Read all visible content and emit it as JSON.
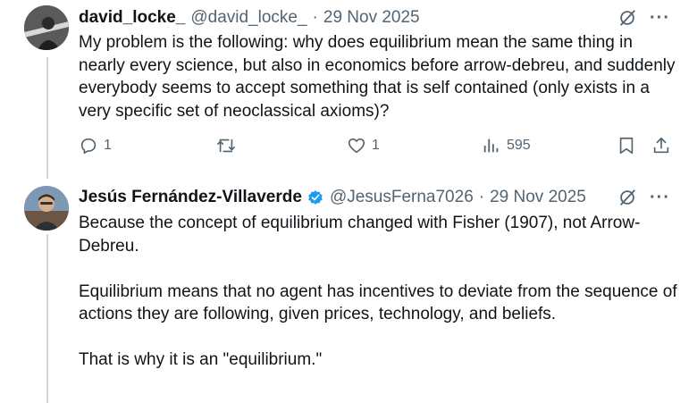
{
  "tweets": [
    {
      "name": "david_locke_",
      "handle": "@david_locke_",
      "separator": "·",
      "date": "29 Nov 2025",
      "more_label": "···",
      "text": "My problem is the following: why does equilibrium mean the same thing in nearly every science, but also in economics before arrow-debreu, and suddenly everybody seems to accept something that is self contained (only exists in a very specific set of neoclassical axioms)?",
      "actions": {
        "replies": "1",
        "reposts": "",
        "likes": "1",
        "views": "595"
      }
    },
    {
      "name": "Jesús Fernández-Villaverde",
      "handle": "@JesusFerna7026",
      "separator": "·",
      "date": "29 Nov 2025",
      "more_label": "···",
      "paragraphs": [
        "Because the concept of equilibrium changed with Fisher (1907), not Arrow-Debreu.",
        "Equilibrium means that no agent has incentives to deviate from the sequence of actions they are following, given prices, technology, and beliefs.",
        "That is why it is an \"equilibrium.\""
      ]
    }
  ],
  "colors": {
    "text": "#0f1419",
    "secondary": "#536471",
    "verified": "#1d9bf0",
    "thread_line": "#cfd9de"
  }
}
